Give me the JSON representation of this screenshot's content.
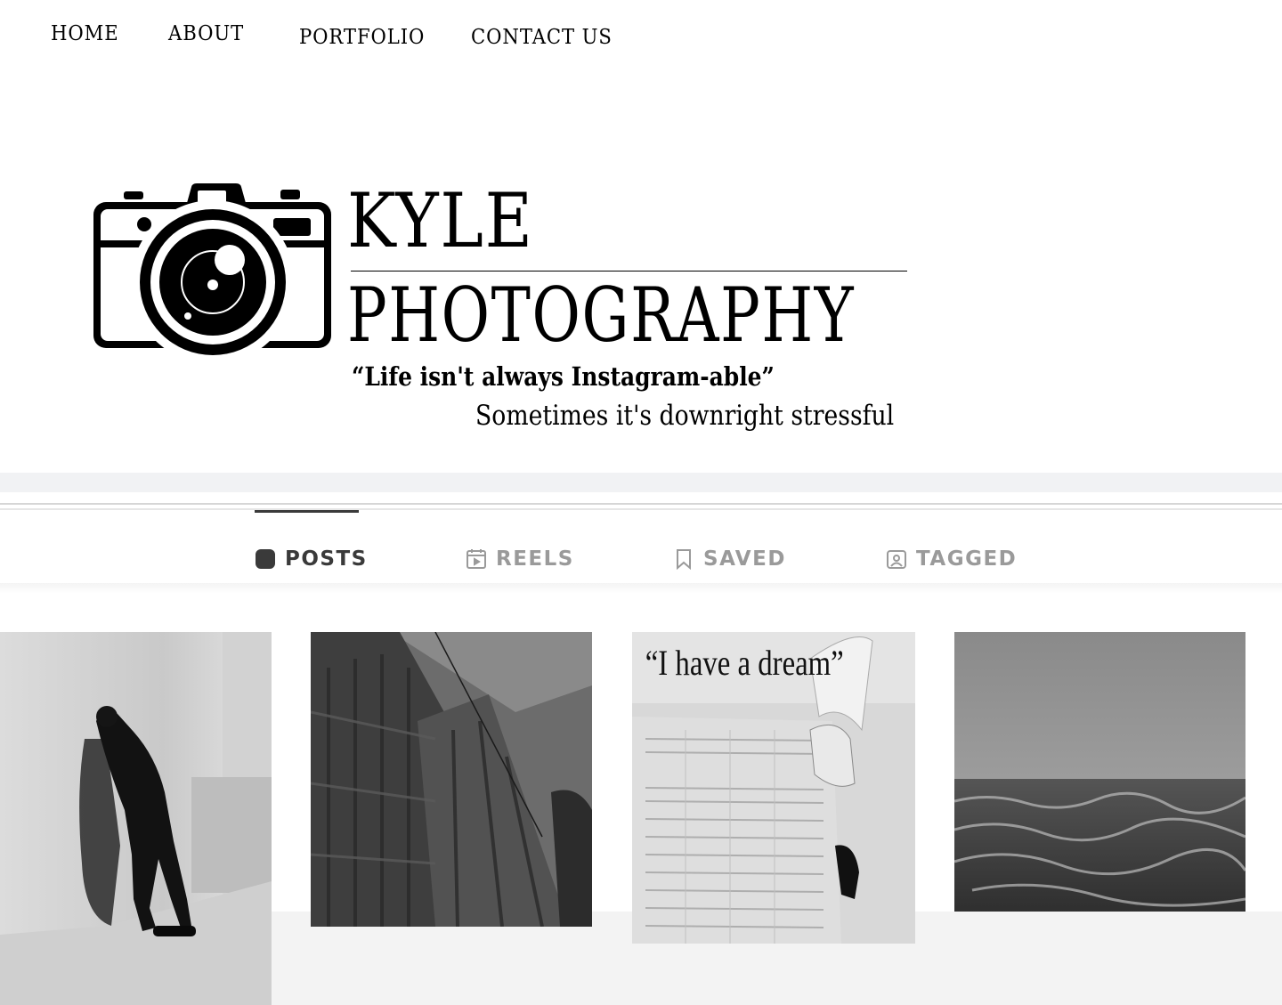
{
  "nav": {
    "items": [
      {
        "label": "HOME"
      },
      {
        "label": "ABOUT"
      },
      {
        "label": "PORTFOLIO"
      },
      {
        "label": "CONTACT US"
      }
    ]
  },
  "header": {
    "logo_icon": "camera-icon",
    "brand_first": "KYLE",
    "brand_second": "PHOTOGRAPHY",
    "tagline": "“Life isn't always Instagram-able”",
    "subtagline": "Sometimes it's downright stressful"
  },
  "profile_tabs": {
    "active": "POSTS",
    "items": [
      {
        "label": "POSTS",
        "icon": "grid-icon"
      },
      {
        "label": "REELS",
        "icon": "reels-icon"
      },
      {
        "label": "SAVED",
        "icon": "bookmark-icon"
      },
      {
        "label": "TAGGED",
        "icon": "tag-icon"
      }
    ]
  },
  "posts": [
    {
      "subject": "man-leaning-on-wall-photo"
    },
    {
      "subject": "building-facade-photo"
    },
    {
      "subject": "newspaper-photo",
      "headline": "“I have a dream”"
    },
    {
      "subject": "stormy-sea-photo"
    }
  ],
  "colors": {
    "text": "#000000",
    "tab_active": "#3a3a3a",
    "tab_inactive": "#9a9a9a",
    "strip": "#f1f2f4"
  }
}
